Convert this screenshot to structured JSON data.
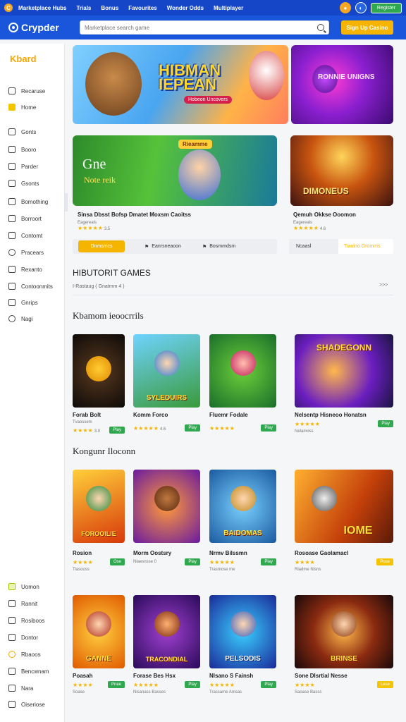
{
  "topbar": {
    "links": [
      "Marketplace Hubs",
      "Trials",
      "Bonus",
      "Favourites",
      "Wonder Odds",
      "Multiplayer"
    ],
    "join_label": "Register"
  },
  "header": {
    "brand": "Crypder",
    "search_placeholder": "Marketplace search game",
    "signup_label": "Sign Up Casino"
  },
  "sidebar": {
    "title": "Kbard",
    "items": [
      {
        "label": "Recaruse",
        "icon": "home-icon"
      },
      {
        "label": "Home",
        "icon": "star-icon"
      },
      {
        "label": "Gonts",
        "icon": "games-icon"
      },
      {
        "label": "Booro",
        "icon": "book-icon"
      },
      {
        "label": "Parder",
        "icon": "box-icon"
      },
      {
        "label": "Gsonts",
        "icon": "chart-icon"
      },
      {
        "label": "Bomothing",
        "icon": "bookmark-icon"
      },
      {
        "label": "Borroort",
        "icon": "list-icon"
      },
      {
        "label": "Contomt",
        "icon": "contact-icon"
      },
      {
        "label": "Pracears",
        "icon": "user-icon"
      },
      {
        "label": "Rexanto",
        "icon": "doc-icon"
      },
      {
        "label": "Contoonmits",
        "icon": "calendar-icon"
      },
      {
        "label": "Gnrips",
        "icon": "lock-icon"
      },
      {
        "label": "Nagi",
        "icon": "globe-icon"
      }
    ],
    "bottom_items": [
      {
        "label": "Uomon",
        "icon": "square-icon"
      },
      {
        "label": "Rannit",
        "icon": "money-icon"
      },
      {
        "label": "Rosiboos",
        "icon": "box-icon"
      },
      {
        "label": "Dontor",
        "icon": "user-icon"
      },
      {
        "label": "Rbaoos",
        "icon": "coin-icon"
      },
      {
        "label": "Bencwnam",
        "icon": "mail-icon"
      },
      {
        "label": "Nara",
        "icon": "chat-icon"
      },
      {
        "label": "Oiseriose",
        "icon": "map-icon"
      }
    ]
  },
  "hero": {
    "main_title_1": "HIBMAN",
    "main_title_2": "IEPEAN",
    "main_tagline": "Hobeon Uncovers",
    "side_title": "RONNIE UNIGNS"
  },
  "featured": {
    "left": {
      "title": "Gne",
      "subtitle": "Note reik",
      "banner": "Rieamme",
      "caption": "Sinsa Dbsst Bofsp Dmatet Moxsm Caoitss",
      "sub": "Eagereals",
      "rating": "3.5"
    },
    "right": {
      "title": "DIMONEUS",
      "caption": "Qemuh Okkse Ooomon",
      "sub": "Eagereals",
      "rating": "4.6"
    },
    "actions": [
      "Dnmsmcs",
      "Eanrsneaoon",
      "Bosmmdsm",
      "Ncaasl",
      "Tiaulno Gromms"
    ]
  },
  "sections": {
    "history_title": "HIBUTORIT GAMES",
    "history_crumb": "I-Rastaug ( Gnatmm 4 )",
    "more": ">>>",
    "recent_title": "Kbamom ieoocrrils",
    "popular_title": "Kongunr Iloconn"
  },
  "tiles_row1": [
    {
      "name": "Forab Bolt",
      "sub": "Tvaossem",
      "rating": "3.0",
      "play": "Play",
      "label": "",
      "style": "t1"
    },
    {
      "name": "Komm Forco",
      "sub": "",
      "rating": "4.6",
      "play": "Play",
      "label": "SYLEDUIRS",
      "style": "t2"
    },
    {
      "name": "Fluemr Fodale",
      "sub": "",
      "rating": "",
      "play": "Play",
      "label": "",
      "style": "t3"
    },
    {
      "name": "Nelsentp Hisneoo Honatsn",
      "sub": "Nelamoss",
      "rating": "",
      "play": "Play",
      "label": "SHADEGONN",
      "style": "t4"
    }
  ],
  "tiles_row2": [
    {
      "name": "Rosion",
      "sub": "Tiasooss",
      "rating": "",
      "play": "Ose",
      "label": "FOROOILIE",
      "style": "t5"
    },
    {
      "name": "Morm Oostsry",
      "sub": "Nlaesnsse 0",
      "rating": "",
      "play": "Play",
      "label": "",
      "style": "t6"
    },
    {
      "name": "Nrmv Bilssmn",
      "sub": "Trasmose me",
      "rating": "",
      "play": "Play",
      "label": "BAIDOMAS",
      "style": "t7"
    },
    {
      "name": "Rosoase Gaolamacl",
      "sub": "Riadme Nlsns",
      "rating": "",
      "play": "Pose",
      "label": "IOME",
      "style": "t8"
    }
  ],
  "tiles_row3": [
    {
      "name": "Poasah",
      "sub": "Soase",
      "rating": "",
      "play": "Pnee",
      "label": "GANNE",
      "style": "t9"
    },
    {
      "name": "Forase Bes Hsx",
      "sub": "Nisanass Basses",
      "rating": "",
      "play": "Play",
      "label": "TRACONDIAL",
      "style": "t10"
    },
    {
      "name": "Nlsano S Fainsh",
      "sub": "Trassame Amsas",
      "rating": "",
      "play": "Play",
      "label": "PELSODIS",
      "style": "t11"
    },
    {
      "name": "Sone Dlsrtial Nesse",
      "sub": "Saoase Basss",
      "rating": "",
      "play": "Lese",
      "label": "BRINSE",
      "style": "t12"
    }
  ],
  "colors": {
    "topbar": "#1546c8",
    "header": "#1a56db",
    "accent": "#f5b400",
    "play_green": "#2fa84f"
  }
}
